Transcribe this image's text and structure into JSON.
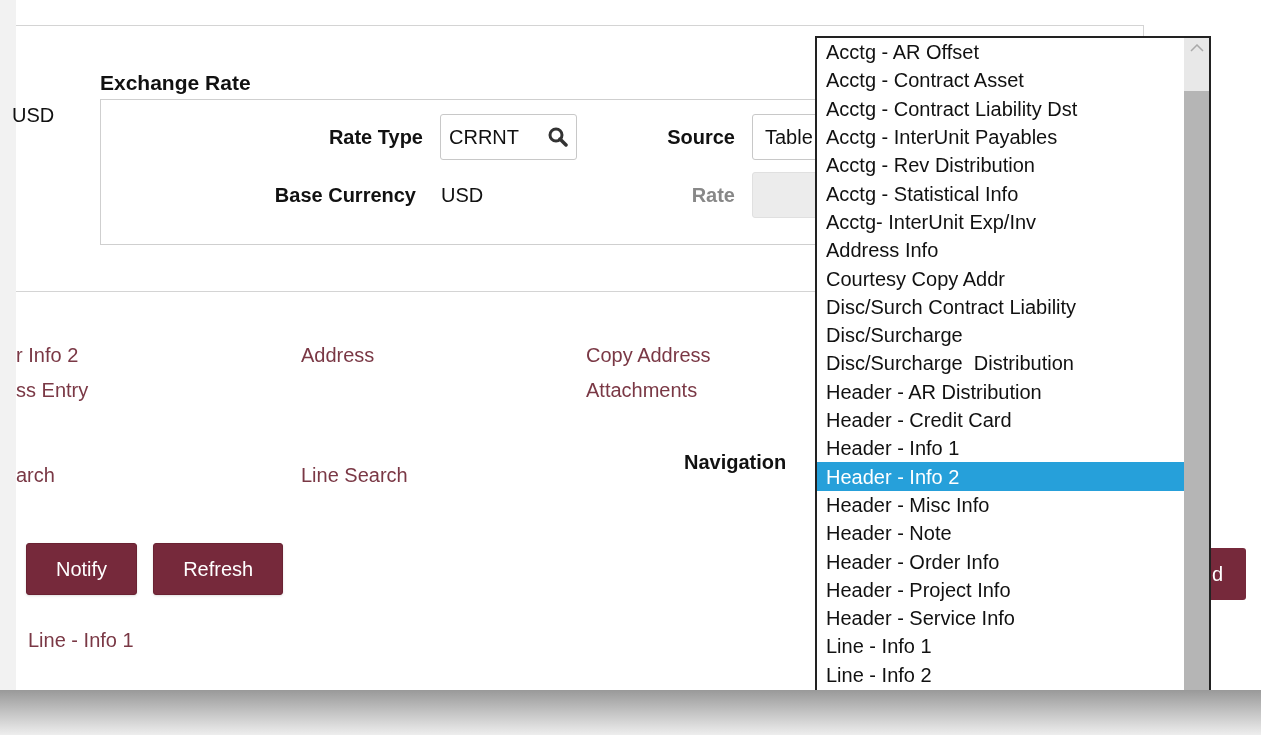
{
  "currency_value": "USD",
  "exchange_rate": {
    "title": "Exchange Rate",
    "rate_type": {
      "label": "Rate Type",
      "value": "CRRNT"
    },
    "source": {
      "label": "Source",
      "value": "Table"
    },
    "base_currency": {
      "label": "Base Currency",
      "value": "USD"
    },
    "rate": {
      "label": "Rate",
      "disabled": true
    }
  },
  "link_columns": [
    [
      "r Info 2",
      "ss Entry"
    ],
    [
      "Address"
    ],
    [
      "Copy Address",
      "Attachments"
    ]
  ],
  "search_links": [
    "arch",
    "Line Search"
  ],
  "navigation": {
    "label": "Navigation"
  },
  "buttons": [
    "Notify",
    "Refresh"
  ],
  "right_button": "d",
  "bottom_link": "Line - Info 1",
  "dropdown": [
    {
      "label": "Acctg - AR Offset",
      "selected": false
    },
    {
      "label": "Acctg - Contract Asset",
      "selected": false
    },
    {
      "label": "Acctg - Contract Liability Dst",
      "selected": false
    },
    {
      "label": "Acctg - InterUnit Payables",
      "selected": false
    },
    {
      "label": "Acctg - Rev Distribution",
      "selected": false
    },
    {
      "label": "Acctg - Statistical Info",
      "selected": false
    },
    {
      "label": "Acctg- InterUnit Exp/Inv",
      "selected": false
    },
    {
      "label": "Address Info",
      "selected": false
    },
    {
      "label": "Courtesy Copy Addr",
      "selected": false
    },
    {
      "label": "Disc/Surch Contract Liability",
      "selected": false
    },
    {
      "label": "Disc/Surcharge",
      "selected": false
    },
    {
      "label": "Disc/Surcharge  Distribution",
      "selected": false
    },
    {
      "label": "Header - AR Distribution",
      "selected": false
    },
    {
      "label": "Header - Credit Card",
      "selected": false
    },
    {
      "label": "Header - Info 1",
      "selected": false
    },
    {
      "label": "Header - Info 2",
      "selected": true
    },
    {
      "label": "Header - Misc Info",
      "selected": false
    },
    {
      "label": "Header - Note",
      "selected": false
    },
    {
      "label": "Header - Order Info",
      "selected": false
    },
    {
      "label": "Header - Project Info",
      "selected": false
    },
    {
      "label": "Header - Service Info",
      "selected": false
    },
    {
      "label": "Line - Info 1",
      "selected": false
    },
    {
      "label": "Line - Info 2",
      "selected": false
    }
  ]
}
